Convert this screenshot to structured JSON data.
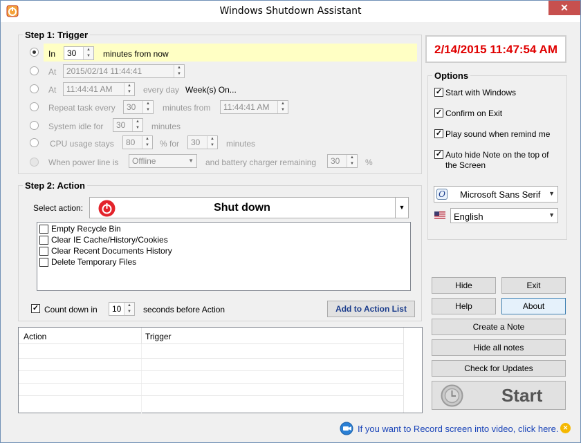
{
  "window": {
    "title": "Windows Shutdown Assistant",
    "close_glyph": "✕"
  },
  "clock": {
    "datetime": "2/14/2015 11:47:54 AM",
    "color": "#e00000"
  },
  "trigger": {
    "title": "Step 1: Trigger",
    "in": {
      "label": "In",
      "minutes": "30",
      "suffix": "minutes from now"
    },
    "at_date": {
      "label": "At",
      "value": "2015/02/14   11:44:41"
    },
    "at_time": {
      "label": "At",
      "value": "11:44:41 AM",
      "every": "every day",
      "weeks": "Week(s) On..."
    },
    "repeat": {
      "label": "Repeat task every",
      "value": "30",
      "middle": "minutes from",
      "from": "11:44:41 AM"
    },
    "idle": {
      "label": "System idle for",
      "value": "30",
      "suffix": "minutes"
    },
    "cpu": {
      "label": "CPU usage stays",
      "value": "80",
      "middle": "% for",
      "value2": "30",
      "suffix": "minutes"
    },
    "power": {
      "label": "When power line is",
      "select": "Offline",
      "middle": "and battery charger remaining",
      "value": "30",
      "suffix": "%"
    }
  },
  "action": {
    "title": "Step 2: Action",
    "select_label": "Select action:",
    "selected": "Shut down",
    "options": [
      "Empty Recycle Bin",
      "Clear IE Cache/History/Cookies",
      "Clear Recent Documents History",
      "Delete Temporary Files"
    ],
    "countdown": {
      "label": "Count down in",
      "value": "10",
      "suffix": "seconds before Action"
    },
    "add_button": "Add to Action List"
  },
  "action_list": {
    "columns": [
      "Action",
      "Trigger"
    ]
  },
  "options": {
    "title": "Options",
    "items": [
      {
        "label": "Start with Windows",
        "checked": true
      },
      {
        "label": "Confirm on Exit",
        "checked": true
      },
      {
        "label": "Play sound when remind me",
        "checked": true
      },
      {
        "label": "Auto hide Note on the top of the Screen",
        "checked": true
      }
    ],
    "check_glyph": "✓",
    "font": "Microsoft Sans Serif",
    "language": "English"
  },
  "buttons": {
    "hide": "Hide",
    "exit": "Exit",
    "help": "Help",
    "about": "About",
    "create_note": "Create a Note",
    "hide_notes": "Hide all notes",
    "check_updates": "Check for Updates",
    "start": "Start"
  },
  "footer": {
    "link": "If you want to Record screen into video, click here."
  }
}
